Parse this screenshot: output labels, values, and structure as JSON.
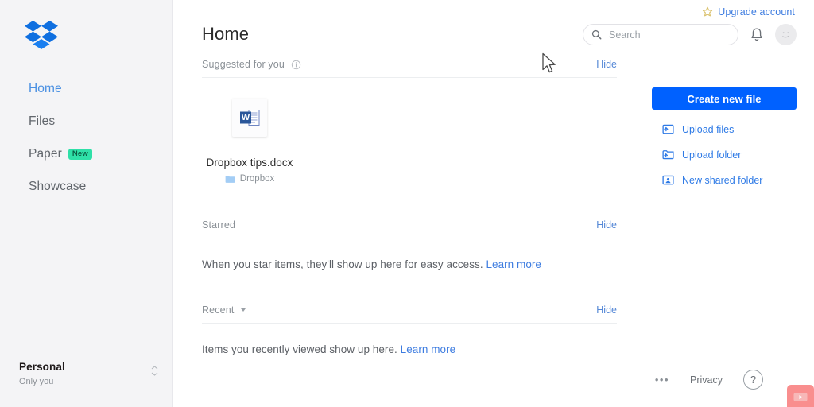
{
  "sidebar": {
    "logo": "dropbox-logo",
    "items": [
      {
        "label": "Home",
        "active": true,
        "badge": null
      },
      {
        "label": "Files",
        "active": false,
        "badge": null
      },
      {
        "label": "Paper",
        "active": false,
        "badge": "New"
      },
      {
        "label": "Showcase",
        "active": false,
        "badge": null
      }
    ],
    "account": {
      "name": "Personal",
      "subtitle": "Only you"
    }
  },
  "header": {
    "title": "Home",
    "upgrade_label": "Upgrade account",
    "upgrade_icon": "star-icon",
    "search": {
      "placeholder": "Search",
      "value": ""
    },
    "notifications_icon": "bell-icon",
    "avatar_label": "account-avatar"
  },
  "sections": {
    "suggested": {
      "title": "Suggested for you",
      "info_icon": "info-icon",
      "hide_label": "Hide",
      "files": [
        {
          "name": "Dropbox tips.docx",
          "location": "Dropbox",
          "icon": "word-doc-icon",
          "folder_icon": "folder-icon"
        }
      ]
    },
    "starred": {
      "title": "Starred",
      "hide_label": "Hide",
      "empty_text": "When you star items, they'll show up here for easy access.",
      "learn_more": "Learn more"
    },
    "recent": {
      "title": "Recent",
      "caret_icon": "chevron-down-icon",
      "hide_label": "Hide",
      "empty_text": "Items you recently viewed show up here.",
      "learn_more": "Learn more"
    }
  },
  "right_rail": {
    "create_label": "Create new file",
    "actions": [
      {
        "label": "Upload files",
        "icon": "upload-file-icon"
      },
      {
        "label": "Upload folder",
        "icon": "upload-folder-icon"
      },
      {
        "label": "New shared folder",
        "icon": "shared-folder-icon"
      }
    ]
  },
  "footer": {
    "more_label": "•••",
    "privacy_label": "Privacy",
    "help_label": "?"
  },
  "colors": {
    "brand_blue": "#0061ff",
    "link_blue": "#3d7ce0",
    "sidebar_bg": "#f4f4f6",
    "badge_green": "#2fe0a8",
    "corner_red": "#f98e8e"
  }
}
